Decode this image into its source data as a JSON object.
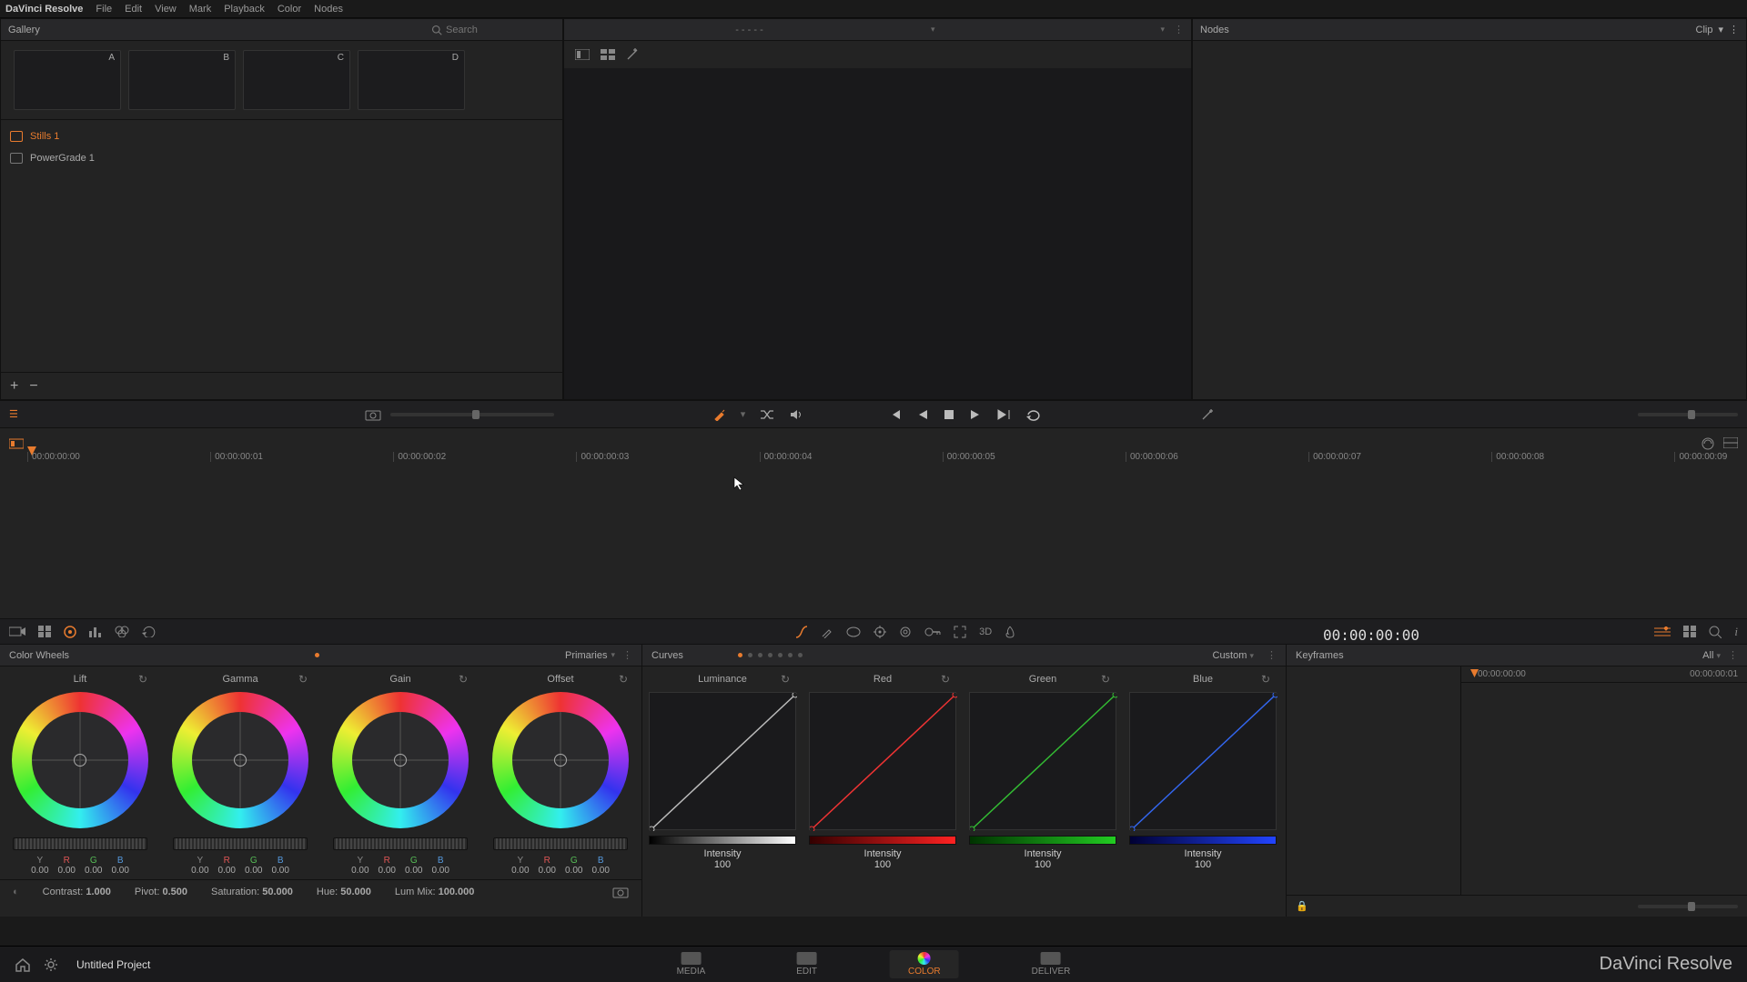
{
  "app_name": "DaVinci Resolve",
  "menu": [
    "File",
    "Edit",
    "View",
    "Mark",
    "Playback",
    "Color",
    "Nodes"
  ],
  "gallery": {
    "title": "Gallery",
    "search_placeholder": "Search",
    "thumbs": [
      "A",
      "B",
      "C",
      "D"
    ],
    "albums": {
      "stills": "Stills 1",
      "powergrade": "PowerGrade 1"
    }
  },
  "viewer": {
    "dropdown": "- - - - -"
  },
  "nodes": {
    "title": "Nodes",
    "mode": "Clip"
  },
  "timeline": {
    "ticks": [
      "00:00:00:00",
      "00:00:00:01",
      "00:00:00:02",
      "00:00:00:03",
      "00:00:00:04",
      "00:00:00:05",
      "00:00:00:06",
      "00:00:00:07",
      "00:00:00:08",
      "00:00:00:09"
    ]
  },
  "colorwheels": {
    "title": "Color Wheels",
    "mode": "Primaries",
    "wheels": [
      {
        "name": "Lift",
        "y": "0.00",
        "r": "0.00",
        "g": "0.00",
        "b": "0.00"
      },
      {
        "name": "Gamma",
        "y": "0.00",
        "r": "0.00",
        "g": "0.00",
        "b": "0.00"
      },
      {
        "name": "Gain",
        "y": "0.00",
        "r": "0.00",
        "g": "0.00",
        "b": "0.00"
      },
      {
        "name": "Offset",
        "y": "0.00",
        "r": "0.00",
        "g": "0.00",
        "b": "0.00"
      }
    ],
    "params": {
      "contrast_label": "Contrast:",
      "contrast": "1.000",
      "pivot_label": "Pivot:",
      "pivot": "0.500",
      "saturation_label": "Saturation:",
      "saturation": "50.000",
      "hue_label": "Hue:",
      "hue": "50.000",
      "lummix_label": "Lum Mix:",
      "lummix": "100.000"
    }
  },
  "curves": {
    "title": "Curves",
    "mode": "Custom",
    "channels": [
      {
        "name": "Luminance",
        "intensity_label": "Intensity",
        "intensity": "100",
        "color": "#bbb"
      },
      {
        "name": "Red",
        "intensity_label": "Intensity",
        "intensity": "100",
        "color": "#e33"
      },
      {
        "name": "Green",
        "intensity_label": "Intensity",
        "intensity": "100",
        "color": "#3b3"
      },
      {
        "name": "Blue",
        "intensity_label": "Intensity",
        "intensity": "100",
        "color": "#36e"
      }
    ]
  },
  "keyframes": {
    "title": "Keyframes",
    "filter": "All",
    "tc": "00:00:00:00",
    "ruler": [
      "00:00:00:00",
      "00:00:00:01"
    ]
  },
  "pages": {
    "media": "MEDIA",
    "edit": "EDIT",
    "color": "COLOR",
    "deliver": "DELIVER"
  },
  "project": "Untitled Project",
  "brand": "DaVinci Resolve",
  "labels": {
    "y": "Y",
    "r": "R",
    "g": "G",
    "b": "B"
  }
}
